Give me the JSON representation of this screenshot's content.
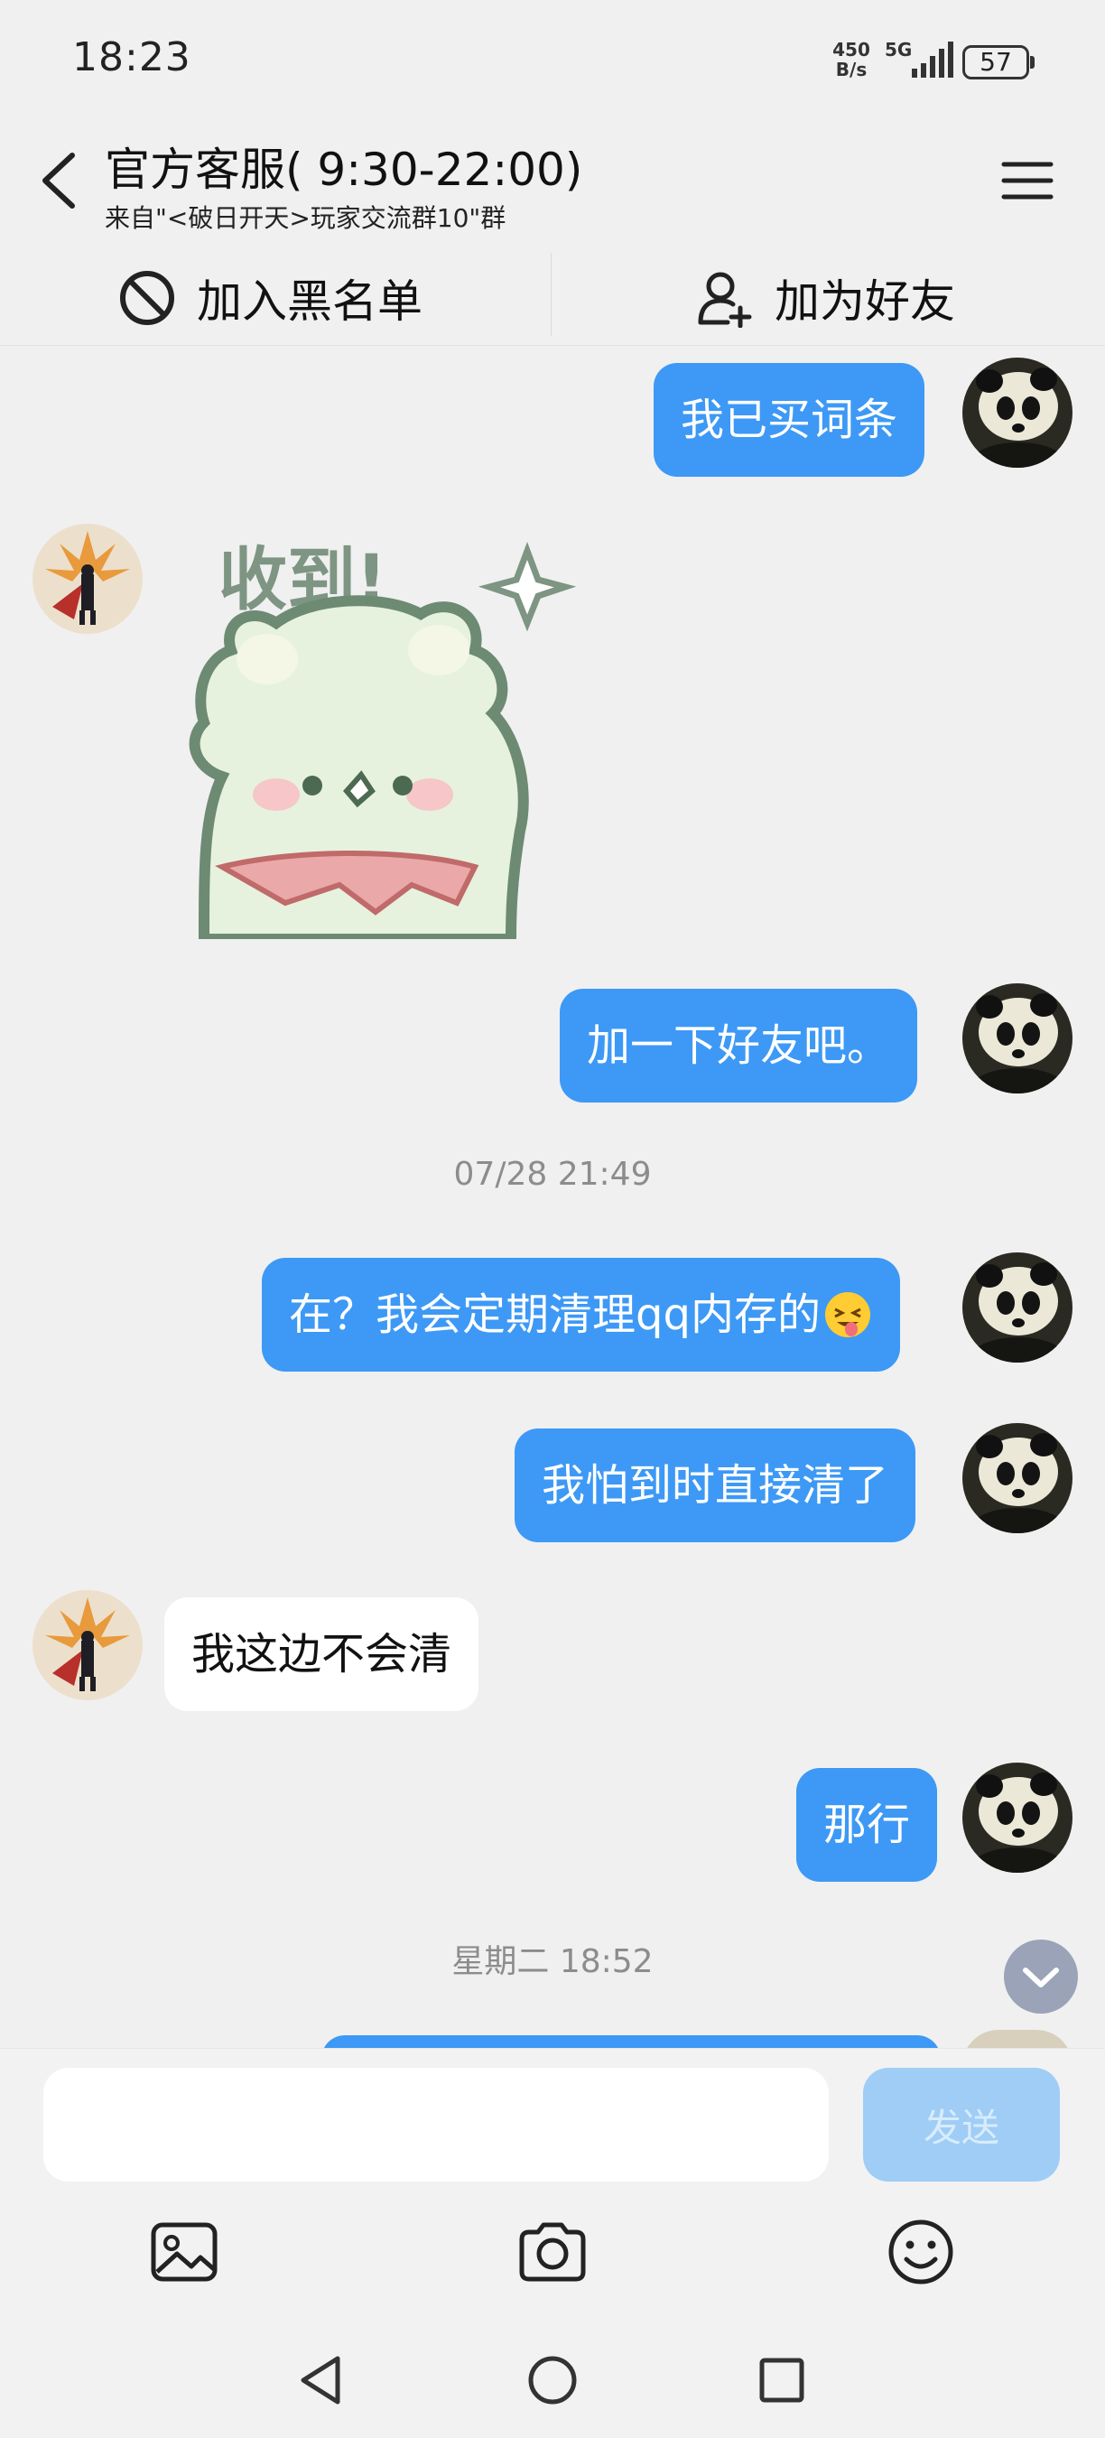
{
  "status_bar": {
    "time": "18:23",
    "net_speed_value": "450",
    "net_speed_unit": "B/s",
    "network_type": "5G",
    "battery": "57"
  },
  "header": {
    "contact_name": "官方客服( 9:30-22:00)",
    "contact_source": "来自\"<破日开天>玩家交流群10\"群"
  },
  "actions": {
    "blacklist_label": "加入黑名单",
    "add_friend_label": "加为好友"
  },
  "messages": [
    {
      "side": "out",
      "text": "我已买词条"
    },
    {
      "side": "in",
      "type": "sticker",
      "text": "收到!"
    },
    {
      "side": "out",
      "text": "加一下好友吧。"
    },
    {
      "type": "timestamp",
      "text": "07/28 21:49"
    },
    {
      "side": "out",
      "text": "在？我会定期清理qq内存的",
      "emoji": "tongue-out-emoji"
    },
    {
      "side": "out",
      "text": "我怕到时直接清了"
    },
    {
      "side": "in",
      "text": "我这边不会清"
    },
    {
      "side": "out",
      "text": "那行"
    },
    {
      "type": "timestamp",
      "text": "星期二 18:52"
    }
  ],
  "input": {
    "value": "",
    "send_label": "发送"
  },
  "toolbar": [
    "image-icon",
    "camera-icon",
    "emoji-icon"
  ],
  "colors": {
    "outgoing_bubble": "#3d99f5",
    "incoming_bubble": "#ffffff",
    "background": "#f0f0f0",
    "send_button": "#9fcdf6"
  }
}
